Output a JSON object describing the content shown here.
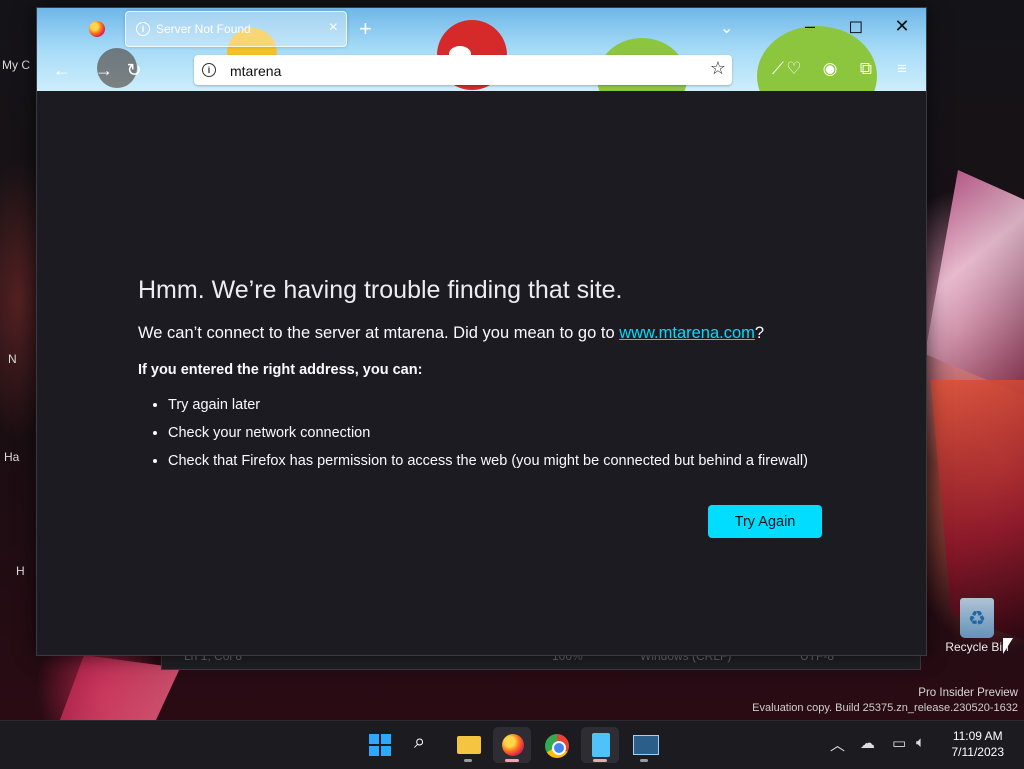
{
  "browser": {
    "tab": {
      "title": "Server Not Found"
    },
    "new_tab_icon": "+",
    "url": {
      "value": "mtarena"
    }
  },
  "error": {
    "title": "Hmm. We’re having trouble finding that site.",
    "description_prefix": "We can’t connect to the server at mtarena. Did you mean to go to ",
    "suggested_link": "www.mtarena.com",
    "description_suffix": "?",
    "subheading": "If you entered the right address, you can:",
    "suggestions": [
      "Try again later",
      "Check your network connection",
      "Check that Firefox has permission to access the web (you might be connected but behind a firewall)"
    ],
    "try_again_label": "Try Again"
  },
  "desktop": {
    "left_labels": [
      "My C",
      "N",
      "Ha",
      "H"
    ],
    "recycle_bin_label": "Recycle Bin",
    "watermark_line1": "Pro Insider Preview",
    "watermark_line2": "Evaluation copy. Build 25375.zn_release.230520-1632",
    "behind_window_status": {
      "position": "Ln 1, Col 8",
      "zoom": "100%",
      "line_ending": "Windows (CRLF)",
      "encoding": "UTF-8"
    }
  },
  "taskbar": {
    "apps": [
      "start-icon",
      "search-icon",
      "file-explorer-icon",
      "firefox-icon",
      "chrome-icon",
      "notepad-icon",
      "task-manager-icon"
    ],
    "clock_time": "11:09 AM",
    "clock_date": "7/11/2023"
  },
  "colors": {
    "accent": "#00ddff",
    "page_background": "#1c1b22",
    "page_text": "#fbfbfe"
  }
}
